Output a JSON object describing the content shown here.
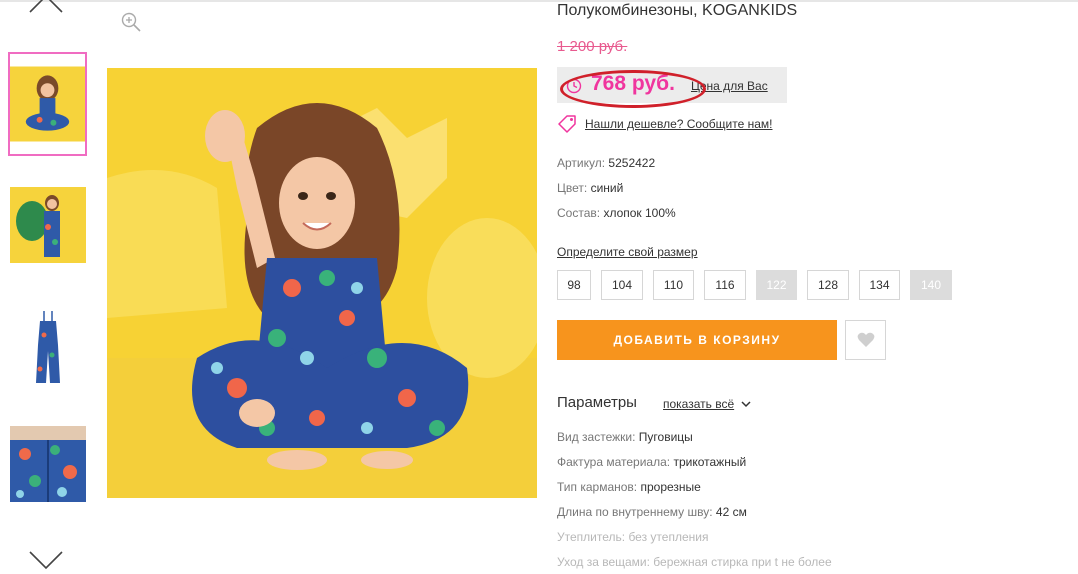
{
  "product": {
    "title": "Полукомбинезоны, KOGANKIDS",
    "old_price": "1 200 руб.",
    "price": "768 руб.",
    "price_note": "Цена для Вас",
    "cheaper_link": "Нашли дешевле? Сообщите нам!"
  },
  "attributes": [
    {
      "key": "Артикул:",
      "value": "5252422"
    },
    {
      "key": "Цвет:",
      "value": "синий"
    },
    {
      "key": "Состав:",
      "value": "хлопок 100%"
    }
  ],
  "sizes": {
    "link_label": "Определите свой размер",
    "options": [
      {
        "label": "98",
        "available": true
      },
      {
        "label": "104",
        "available": true
      },
      {
        "label": "110",
        "available": true
      },
      {
        "label": "116",
        "available": true
      },
      {
        "label": "122",
        "available": false
      },
      {
        "label": "128",
        "available": true
      },
      {
        "label": "134",
        "available": true
      },
      {
        "label": "140",
        "available": false
      }
    ]
  },
  "actions": {
    "add_to_cart": "ДОБАВИТЬ В КОРЗИНУ"
  },
  "params": {
    "title": "Параметры",
    "show_all": "показать всё",
    "items": [
      {
        "key": "Вид застежки:",
        "value": "Пуговицы"
      },
      {
        "key": "Фактура материала:",
        "value": "трикотажный"
      },
      {
        "key": "Тип карманов:",
        "value": "прорезные"
      },
      {
        "key": "Длина по внутреннему шву:",
        "value": "42 см"
      },
      {
        "key": "Утеплитель:",
        "value": "без утепления"
      },
      {
        "key": "Уход за вещами:",
        "value": "бережная стирка при t не более"
      }
    ]
  },
  "colors": {
    "accent_pink": "#f0359e",
    "old_price": "#e85a8f",
    "cart_orange": "#f7941d",
    "thumb_active_border": "#f06cc2",
    "highlight_ring": "#d0202a"
  },
  "icons": [
    "chevron-up-icon",
    "chevron-down-icon",
    "zoom-icon",
    "clock-icon",
    "price-tag-icon",
    "heart-icon"
  ]
}
